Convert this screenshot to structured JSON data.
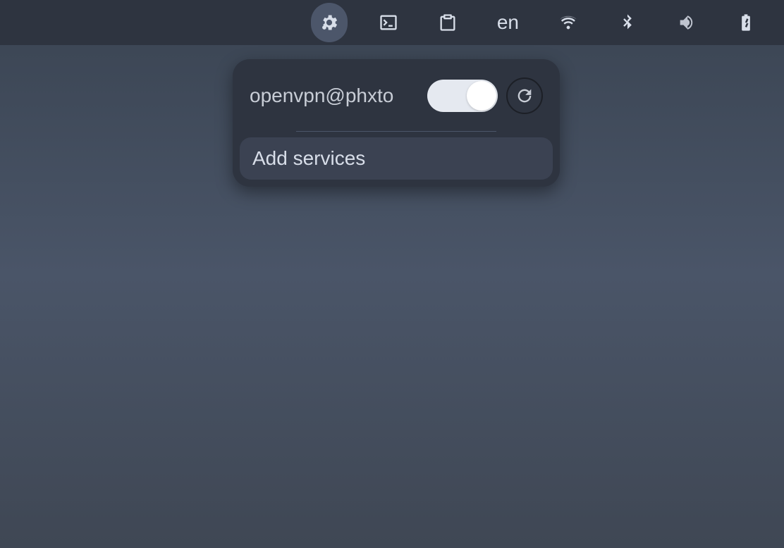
{
  "topbar": {
    "language": "en"
  },
  "panel": {
    "service_name": "openvpn@phxto",
    "toggle_on": true,
    "add_services_label": "Add services"
  }
}
